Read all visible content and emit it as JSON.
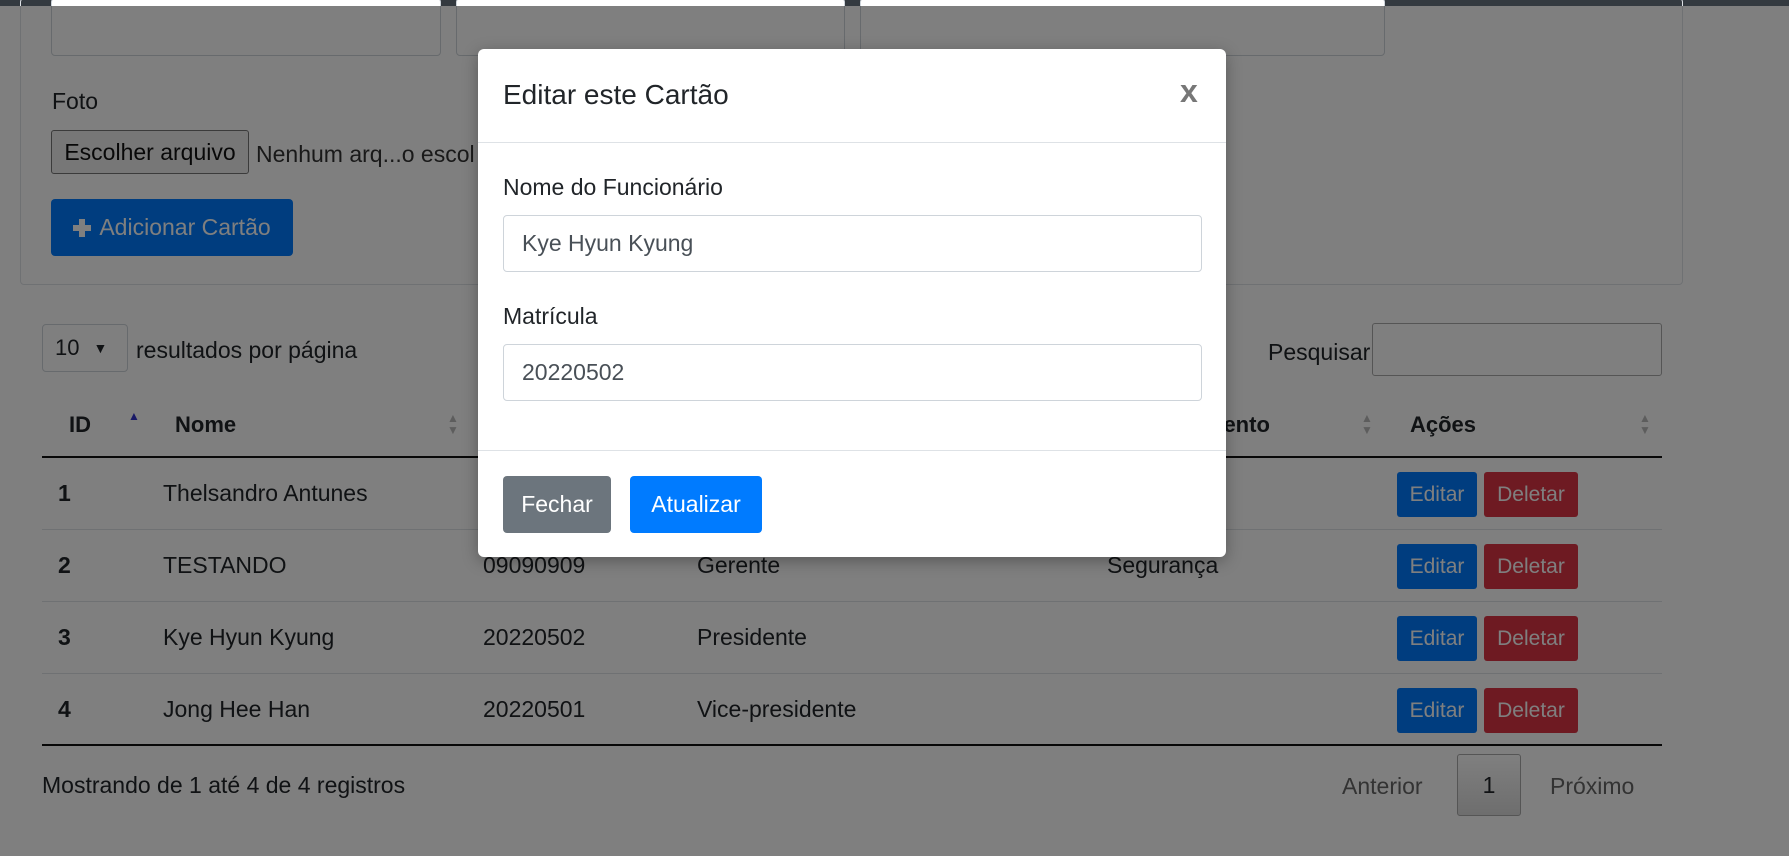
{
  "form": {
    "foto_label": "Foto",
    "file_button": "Escolher arquivo",
    "file_name": "Nenhum arq...o escol",
    "add_button": "Adicionar Cartão"
  },
  "table_controls": {
    "length_value": "10",
    "length_label": "resultados por página",
    "search_label": "Pesquisar",
    "search_value": ""
  },
  "table": {
    "headers": {
      "id": "ID",
      "nome": "Nome",
      "departamento": "nento",
      "acoes": "Ações"
    },
    "rows": [
      {
        "id": "1",
        "nome": "Thelsandro Antunes",
        "matricula": "",
        "cargo": "",
        "departamento": ""
      },
      {
        "id": "2",
        "nome": "TESTANDO",
        "matricula": "09090909",
        "cargo": "Gerente",
        "departamento": "Segurança"
      },
      {
        "id": "3",
        "nome": "Kye Hyun Kyung",
        "matricula": "20220502",
        "cargo": "Presidente",
        "departamento": ""
      },
      {
        "id": "4",
        "nome": "Jong Hee Han",
        "matricula": "20220501",
        "cargo": "Vice-presidente",
        "departamento": ""
      }
    ],
    "edit_label": "Editar",
    "delete_label": "Deletar"
  },
  "footer": {
    "info": "Mostrando de 1 até 4 de 4 registros",
    "prev": "Anterior",
    "page": "1",
    "next": "Próximo"
  },
  "modal": {
    "title": "Editar este Cartão",
    "close_symbol": "x",
    "name_label": "Nome do Funcionário",
    "name_value": "Kye Hyun Kyung",
    "matricula_label": "Matrícula",
    "matricula_value": "20220502",
    "close_button": "Fechar",
    "update_button": "Atualizar"
  },
  "colors": {
    "primary": "#007bff",
    "danger": "#dc3545",
    "secondary": "#6c757d",
    "topbar": "#343a40"
  }
}
